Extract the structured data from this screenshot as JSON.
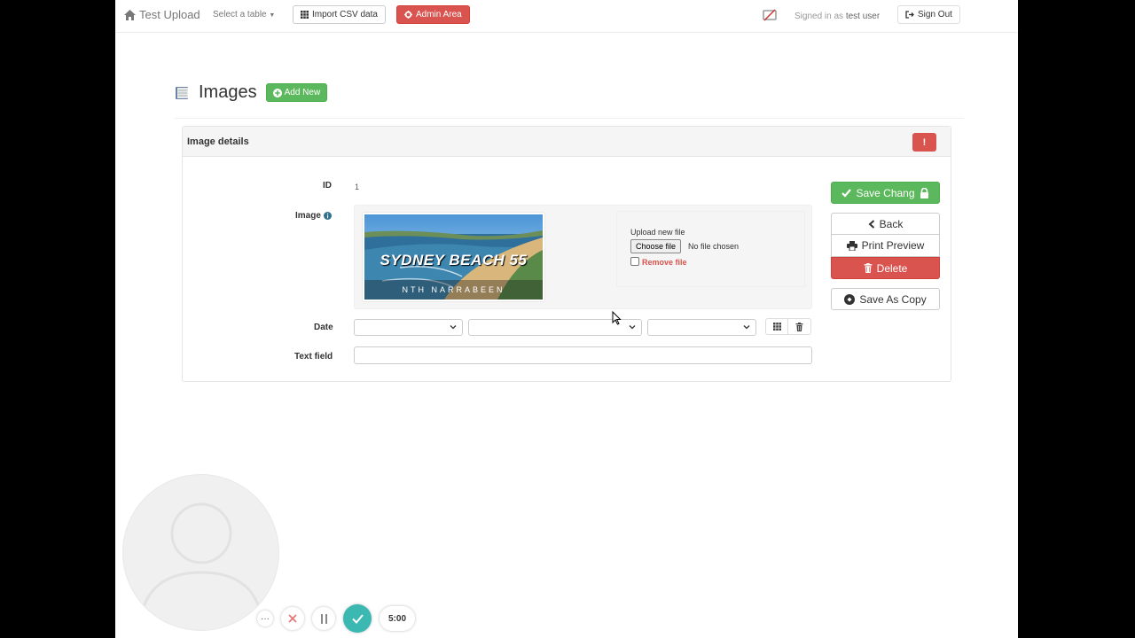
{
  "navbar": {
    "brand": "Test Upload",
    "table_select": "Select a table",
    "import_label": "Import CSV data",
    "admin_label": "Admin Area",
    "signed_in_prefix": "Signed in as",
    "signed_in_user": "test user",
    "signout_label": "Sign Out"
  },
  "heading": {
    "title": "Images",
    "add_new_label": "Add New"
  },
  "panel": {
    "title": "Image details",
    "alert_label": "!"
  },
  "form": {
    "id_label": "ID",
    "id_value": "1",
    "image_label": "Image",
    "image_caption_line1": "SYDNEY BEACH 55",
    "image_caption_line2": "NTH NARRABEEN",
    "upload_title": "Upload new file",
    "choose_file_label": "Choose file",
    "no_file_text": "No file chosen",
    "remove_file_label": "Remove file",
    "date_label": "Date",
    "text_field_label": "Text field",
    "text_field_value": ""
  },
  "actions": {
    "save_label": "Save Chang",
    "back_label": "Back",
    "print_label": "Print Preview",
    "delete_label": "Delete",
    "copy_label": "Save As Copy"
  },
  "recorder": {
    "timer": "5:00",
    "more_label": "···"
  },
  "colors": {
    "success": "#5cb85c",
    "danger": "#d9534f",
    "recorder_accent": "#3cb8b2"
  }
}
